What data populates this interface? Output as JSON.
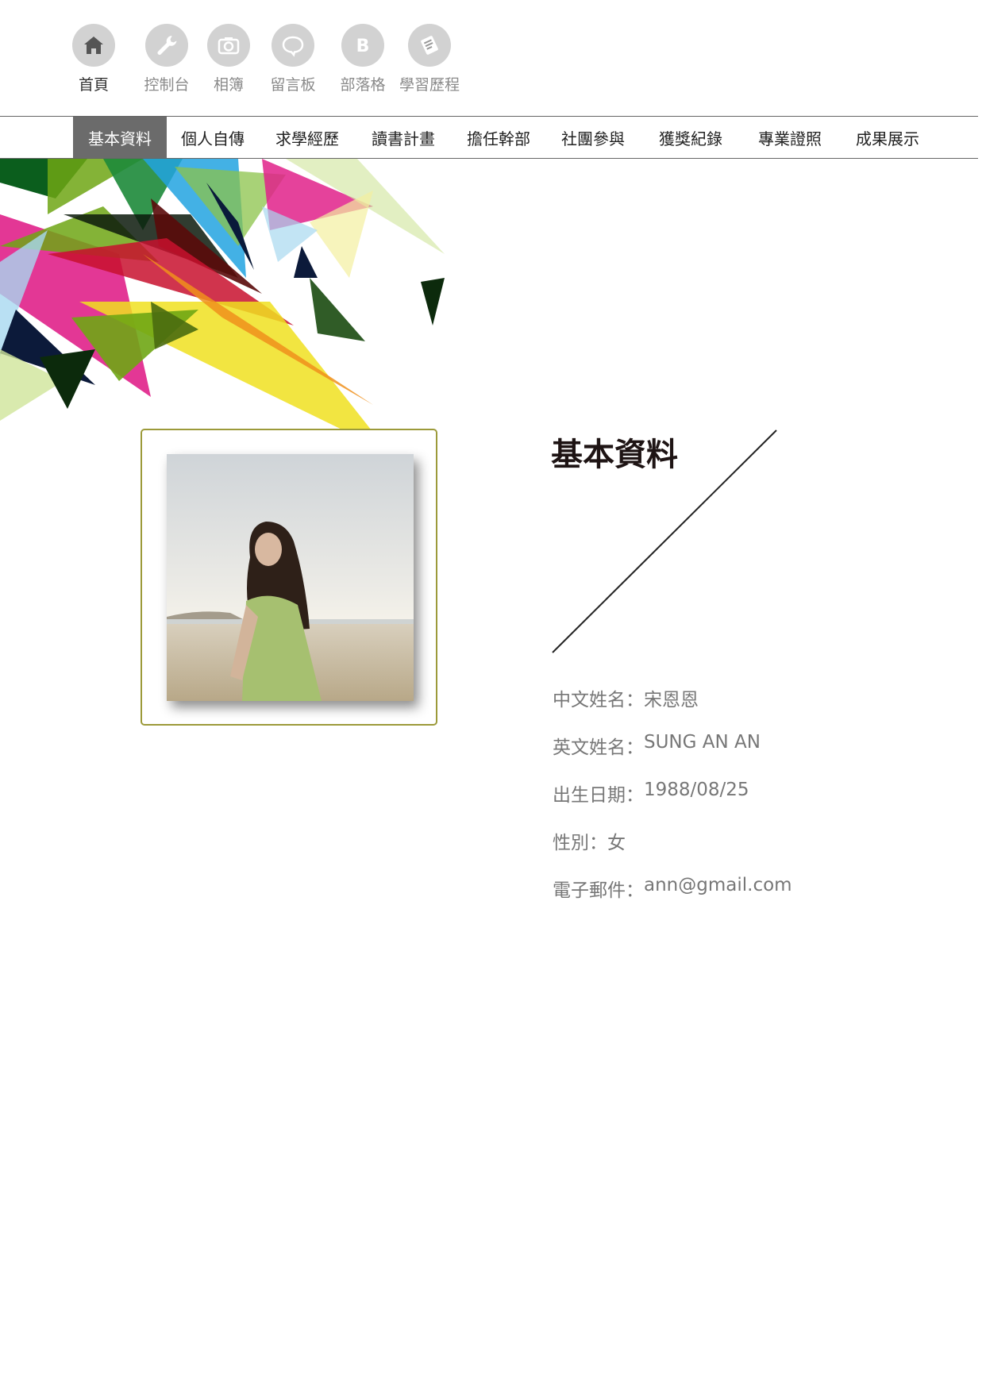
{
  "top_icons": [
    {
      "label": "首頁",
      "icon": "home-icon",
      "current": true
    },
    {
      "label": "控制台",
      "icon": "wrench-icon",
      "current": false
    },
    {
      "label": "相簿",
      "icon": "camera-icon",
      "current": false
    },
    {
      "label": "留言板",
      "icon": "speech-bubble-icon",
      "current": false
    },
    {
      "label": "部落格",
      "icon": "blog-b-icon",
      "current": false
    },
    {
      "label": "學習歷程",
      "icon": "document-icon",
      "current": false
    }
  ],
  "nav": {
    "items": [
      "基本資料",
      "個人自傳",
      "求學經歷",
      "讀書計畫",
      "擔任幹部",
      "社團參與",
      "獲獎紀錄",
      "專業證照",
      "成果展示"
    ],
    "active_index": 0
  },
  "section": {
    "title": "基本資料"
  },
  "profile": {
    "rows": [
      {
        "label": "中文姓名：",
        "value": "宋恩恩"
      },
      {
        "label": "英文姓名：",
        "value": "SUNG AN AN"
      },
      {
        "label": "出生日期：",
        "value": "1988/08/25"
      },
      {
        "label": "性別：",
        "value": "女"
      },
      {
        "label": "電子郵件：",
        "value": "ann@gmail.com"
      }
    ]
  },
  "colors": {
    "frame_border": "#9c9a3a",
    "nav_active_bg": "#6b6b6b",
    "icon_circle": "#d2d2d2"
  }
}
